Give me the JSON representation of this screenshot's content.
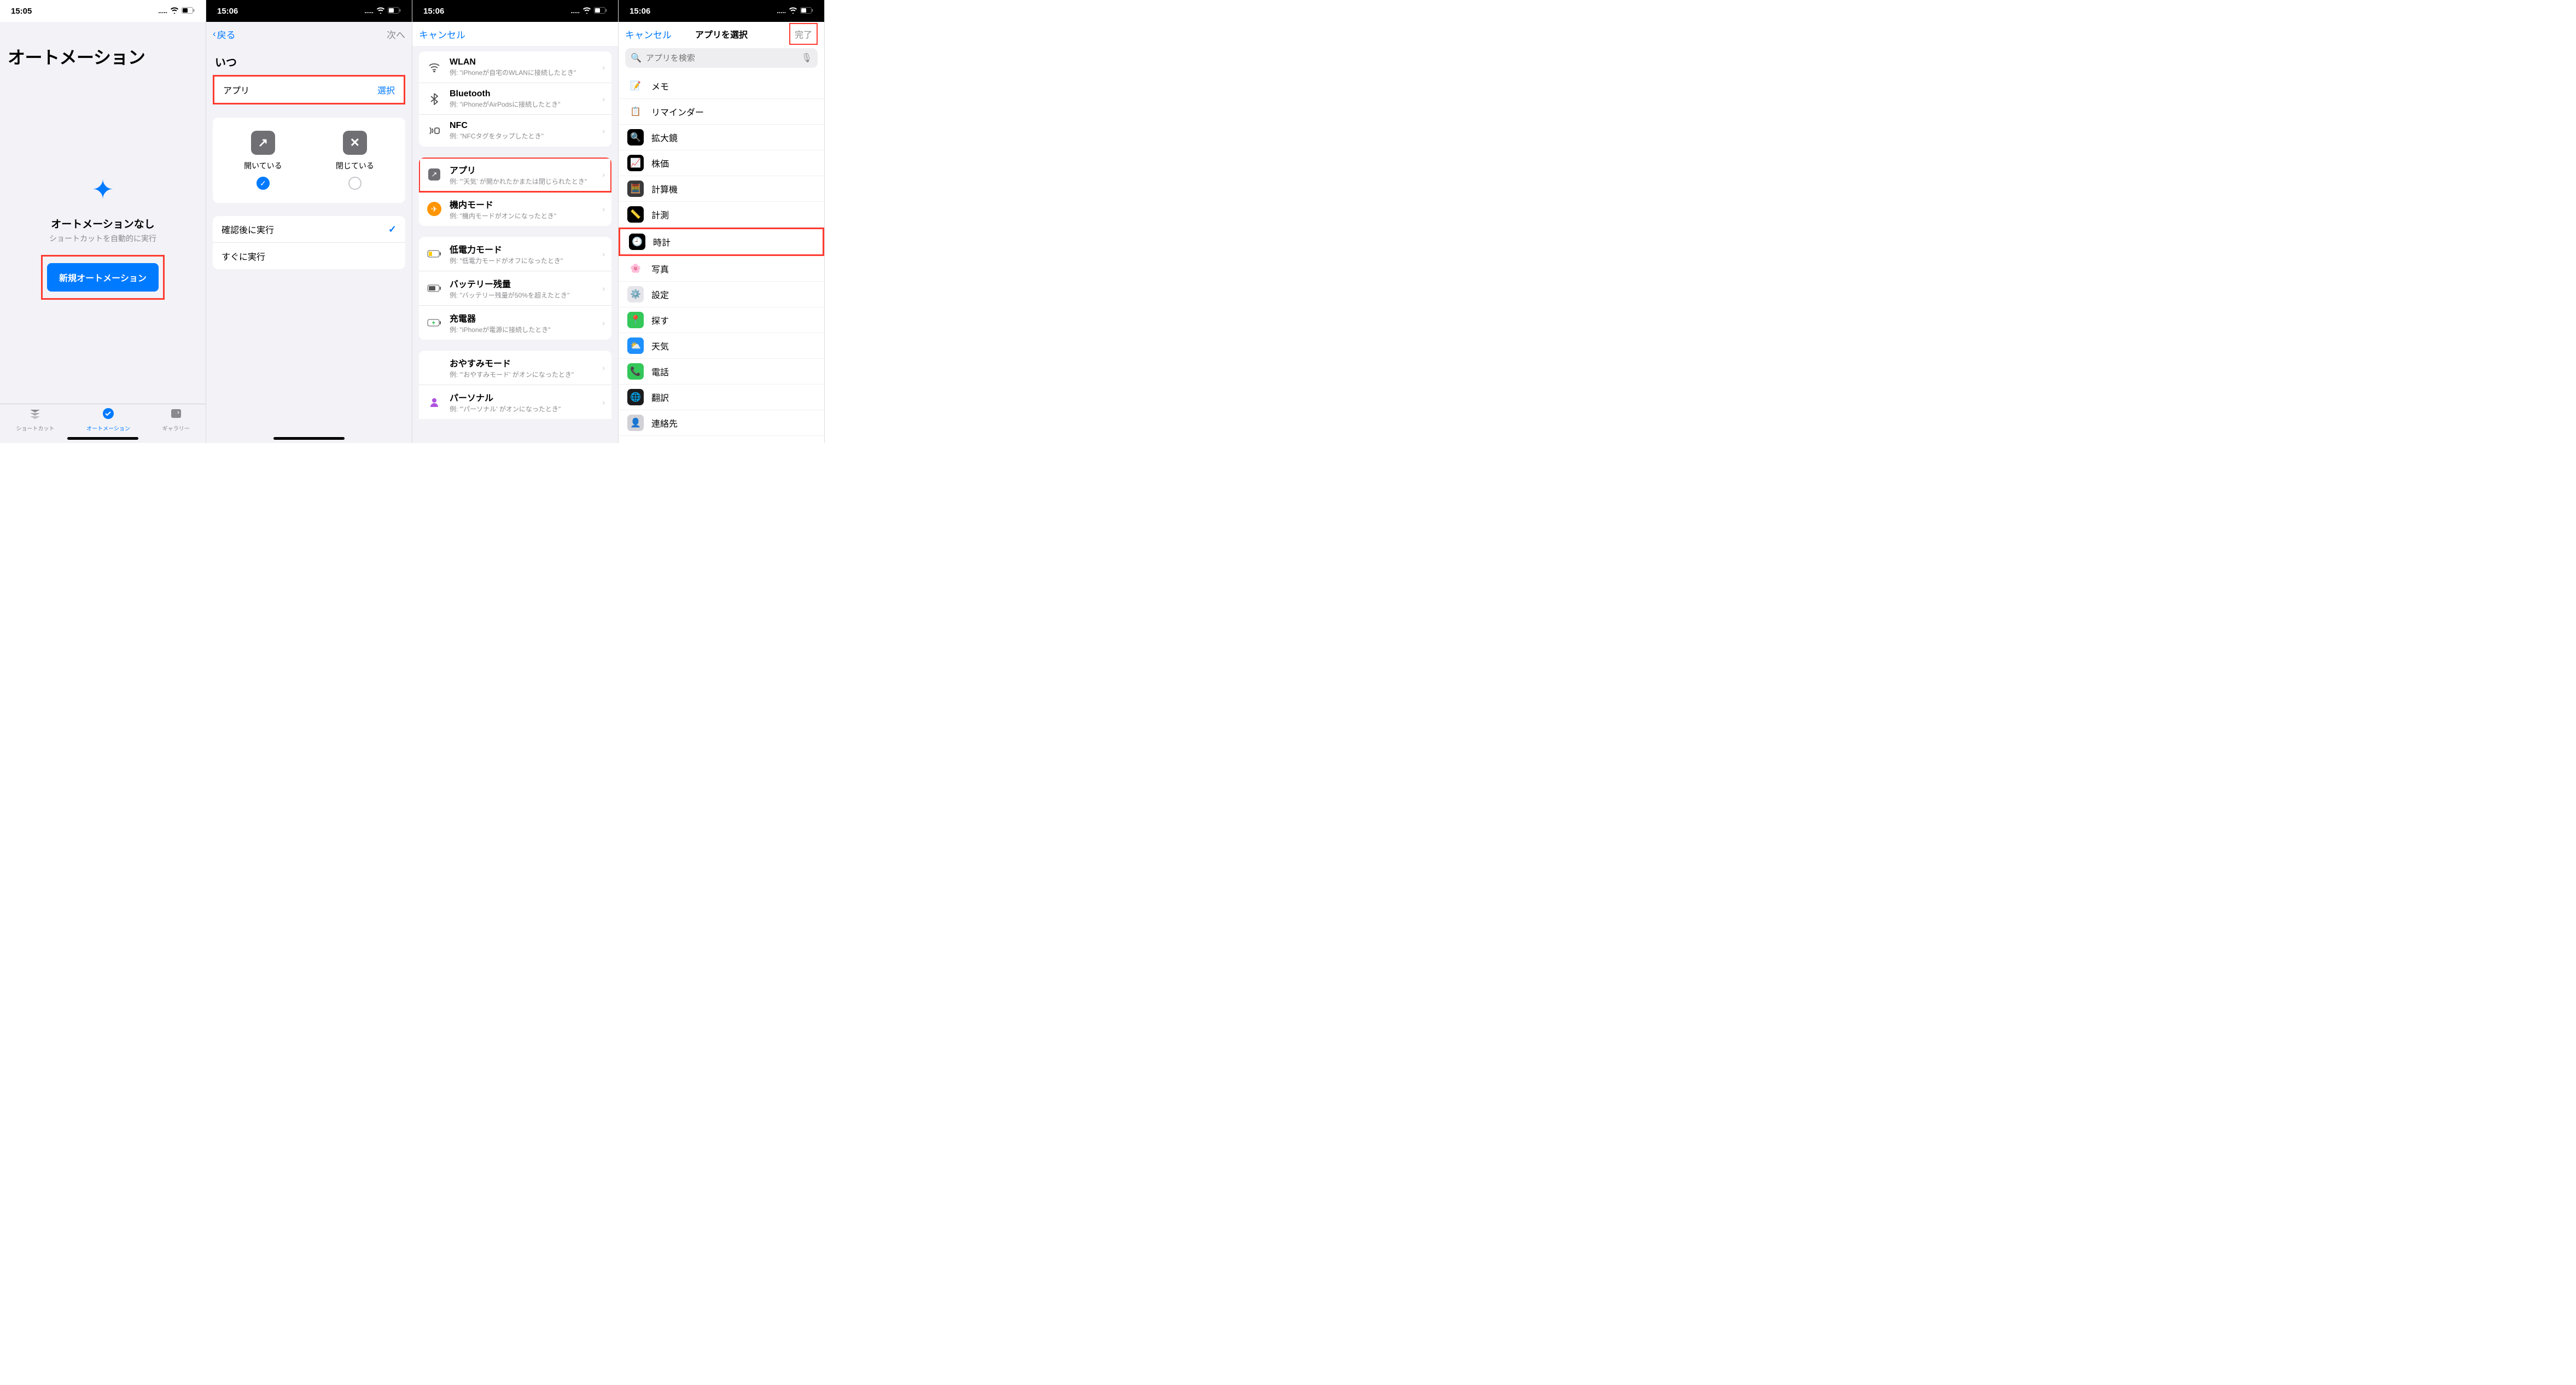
{
  "status": {
    "time1": "15:05",
    "time2": "15:06",
    "dots": "....."
  },
  "s1": {
    "title": "オートメーション",
    "heading": "オートメーションなし",
    "sub": "ショートカットを自動的に実行",
    "button": "新規オートメーション",
    "tabs": [
      "ショートカット",
      "オートメーション",
      "ギャラリー"
    ]
  },
  "s2": {
    "back": "戻る",
    "next": "次へ",
    "when": "いつ",
    "app": "アプリ",
    "choose": "選択",
    "opt_open": "開いている",
    "opt_close": "閉じている",
    "run_after": "確認後に実行",
    "run_now": "すぐに実行"
  },
  "s3": {
    "cancel": "キャンセル",
    "triggers_a": [
      {
        "title": "WLAN",
        "sub": "例: \"iPhoneが自宅のWLANに接続したとき\""
      },
      {
        "title": "Bluetooth",
        "sub": "例: \"iPhoneがAirPodsに接続したとき\""
      },
      {
        "title": "NFC",
        "sub": "例: \"NFCタグをタップしたとき\""
      }
    ],
    "triggers_b": [
      {
        "title": "アプリ",
        "sub": "例: \"'天気' が開かれたかまたは閉じられたとき\""
      },
      {
        "title": "機内モード",
        "sub": "例: \"機内モードがオンになったとき\""
      }
    ],
    "triggers_c": [
      {
        "title": "低電力モード",
        "sub": "例: \"低電力モードがオフになったとき\""
      },
      {
        "title": "バッテリー残量",
        "sub": "例: \"バッテリー残量が50%を超えたとき\""
      },
      {
        "title": "充電器",
        "sub": "例: \"iPhoneが電源に接続したとき\""
      }
    ],
    "triggers_d": [
      {
        "title": "おやすみモード",
        "sub": "例: \"'おやすみモード' がオンになったとき\""
      },
      {
        "title": "パーソナル",
        "sub": "例: \"'パーソナル' がオンになったとき\""
      }
    ]
  },
  "s4": {
    "cancel": "キャンセル",
    "title": "アプリを選択",
    "done": "完了",
    "search_ph": "アプリを検索",
    "apps": [
      "メモ",
      "リマインダー",
      "拡大鏡",
      "株価",
      "計算機",
      "計測",
      "時計",
      "写真",
      "設定",
      "探す",
      "天気",
      "電話",
      "翻訳",
      "連絡先"
    ]
  },
  "app_icons": {
    "メモ": {
      "bg": "#ffffff",
      "glyph": "📝"
    },
    "リマインダー": {
      "bg": "#ffffff",
      "glyph": "📋"
    },
    "拡大鏡": {
      "bg": "#000",
      "glyph": "🔍"
    },
    "株価": {
      "bg": "#000",
      "glyph": "📈"
    },
    "計算機": {
      "bg": "#3a3a3c",
      "glyph": "🧮"
    },
    "計測": {
      "bg": "#000",
      "glyph": "📏"
    },
    "時計": {
      "bg": "#000",
      "glyph": "🕘"
    },
    "写真": {
      "bg": "#fff",
      "glyph": "🌸"
    },
    "設定": {
      "bg": "#e5e5ea",
      "glyph": "⚙️"
    },
    "探す": {
      "bg": "#34c759",
      "glyph": "📍"
    },
    "天気": {
      "bg": "#1e90ff",
      "glyph": "⛅"
    },
    "電話": {
      "bg": "#34c759",
      "glyph": "📞"
    },
    "翻訳": {
      "bg": "#1c1c1e",
      "glyph": "🌐"
    },
    "連絡先": {
      "bg": "#d1d1d6",
      "glyph": "👤"
    }
  }
}
